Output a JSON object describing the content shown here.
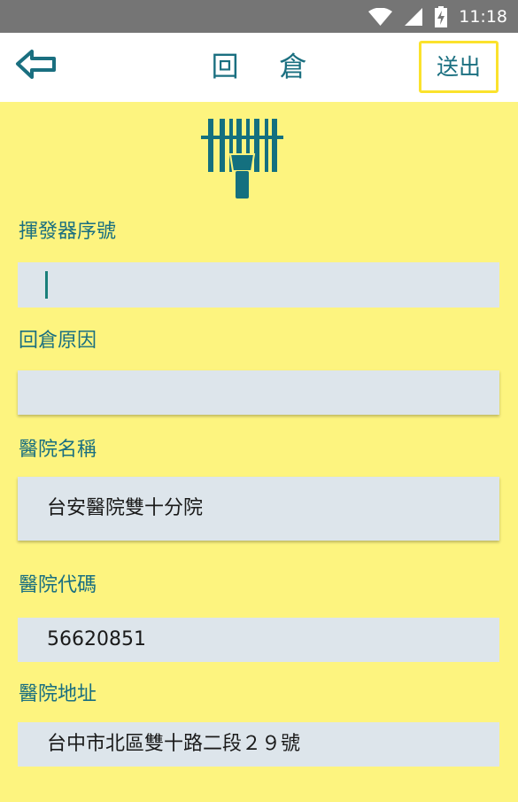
{
  "status_bar": {
    "time": "11:18",
    "icons": [
      "wifi-icon",
      "cell-signal-icon",
      "battery-charging-icon"
    ]
  },
  "app_bar": {
    "back_icon": "arrow-left-icon",
    "title": "回 倉",
    "submit_label": "送出"
  },
  "colors": {
    "background": "#fdf47f",
    "accent": "#1a6f80",
    "field": "#dde5eb",
    "submit_border": "#fbe22c"
  },
  "form": {
    "scanner_icon": "barcode-scanner-icon",
    "fields": [
      {
        "label": "揮發器序號",
        "value": ""
      },
      {
        "label": "回倉原因",
        "value": ""
      },
      {
        "label": "醫院名稱",
        "value": "台安醫院雙十分院"
      },
      {
        "label": "醫院代碼",
        "value": "56620851"
      },
      {
        "label": "醫院地址",
        "value": "台中市北區雙十路二段２９號"
      }
    ]
  }
}
